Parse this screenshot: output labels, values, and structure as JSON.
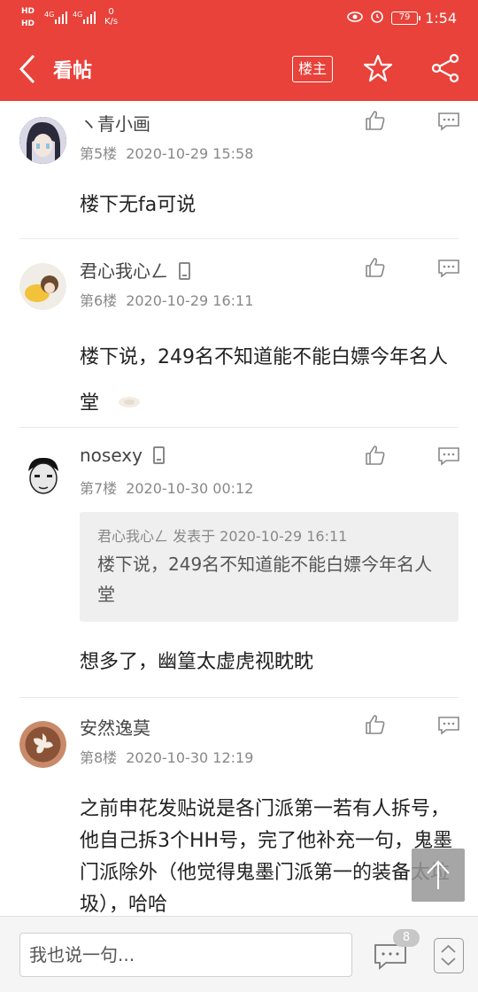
{
  "status": {
    "sim1": "HD",
    "sim2": "HD",
    "net": "4G",
    "speed_value": "0",
    "speed_unit": "K/s",
    "battery": "79",
    "time": "1:54"
  },
  "header": {
    "title": "看帖",
    "louzhu_label": "楼主",
    "accent_color": "#e8423a"
  },
  "posts": [
    {
      "username": "ヽ青小画",
      "floor": "第5楼",
      "time": "2020-10-29 15:58",
      "body": "楼下无fa可说"
    },
    {
      "username": "君心我心ㄥ",
      "floor": "第6楼",
      "time": "2020-10-29 16:11",
      "body": "楼下说，249名不知道能不能白嫖今年名人堂"
    },
    {
      "username": "nosexy",
      "floor": "第7楼",
      "time": "2020-10-30 00:12",
      "quote_head": "君心我心ㄥ 发表于 2020-10-29 16:11",
      "quote_text": "楼下说，249名不知道能不能白嫖今年名人堂",
      "body": "想多了，幽篁太虚虎视眈眈"
    },
    {
      "username": "安然逸莫",
      "floor": "第8楼",
      "time": "2020-10-30 12:19",
      "body": "之前申花发贴说是各门派第一若有人拆号，他自己拆3个HH号，完了他补充一句，鬼墨门派除外（他觉得鬼墨门派第一的装备太垃圾），哈哈"
    }
  ],
  "bottom": {
    "input_placeholder": "我也说一句...",
    "comment_count": "8"
  }
}
